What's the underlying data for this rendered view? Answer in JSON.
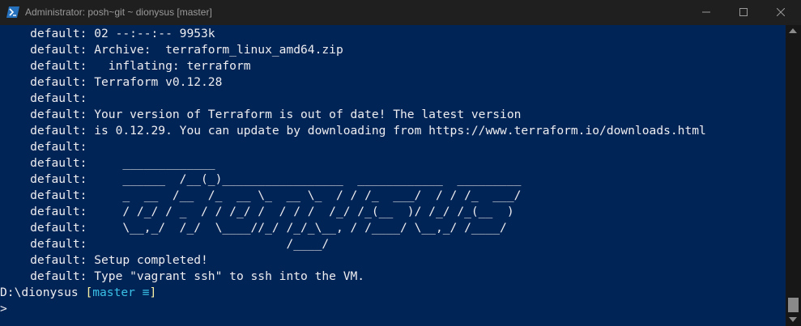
{
  "window": {
    "title": "Administrator: posh~git ~ dionysus [master]"
  },
  "console": {
    "lines": [
      "    default: 02 --:--:-- 9953k",
      "    default: Archive:  terraform_linux_amd64.zip",
      "    default:   inflating: terraform",
      "    default: Terraform v0.12.28",
      "    default:",
      "    default: Your version of Terraform is out of date! The latest version",
      "    default: is 0.12.29. You can update by downloading from https://www.terraform.io/downloads.html",
      "    default:",
      "    default:     _____________",
      "    default:     ______  /__(_)_________________  ____________  _________",
      "    default:     _  __  /__  /_  __ \\_  __ \\_  / / /_  ___/  / / /_  ___/",
      "    default:     / /_/ / _  / / /_/ /  / / /  /_/ /_(__  )/ /_/ /_(__  )",
      "    default:     \\__,_/  /_/  \\____//_/ /_/_\\__, / /____/ \\__,_/ /____/",
      "    default:                            /____/",
      "    default: Setup completed!",
      "    default: Type \"vagrant ssh\" to ssh into the VM."
    ],
    "prompt_path": "D:\\dionysus ",
    "prompt_branch_open": "[",
    "prompt_branch": "master ≡",
    "prompt_branch_close": "]",
    "prompt_caret": ">"
  },
  "colors": {
    "background": "#012456",
    "foreground": "#eeedf0",
    "branch_bracket": "#f9f1a5",
    "branch_name": "#3ac0e6",
    "titlebar": "#1f1f1f"
  },
  "icons": {
    "app": "powershell-icon",
    "minimize": "minimize-icon",
    "maximize": "maximize-icon",
    "close": "close-icon"
  }
}
